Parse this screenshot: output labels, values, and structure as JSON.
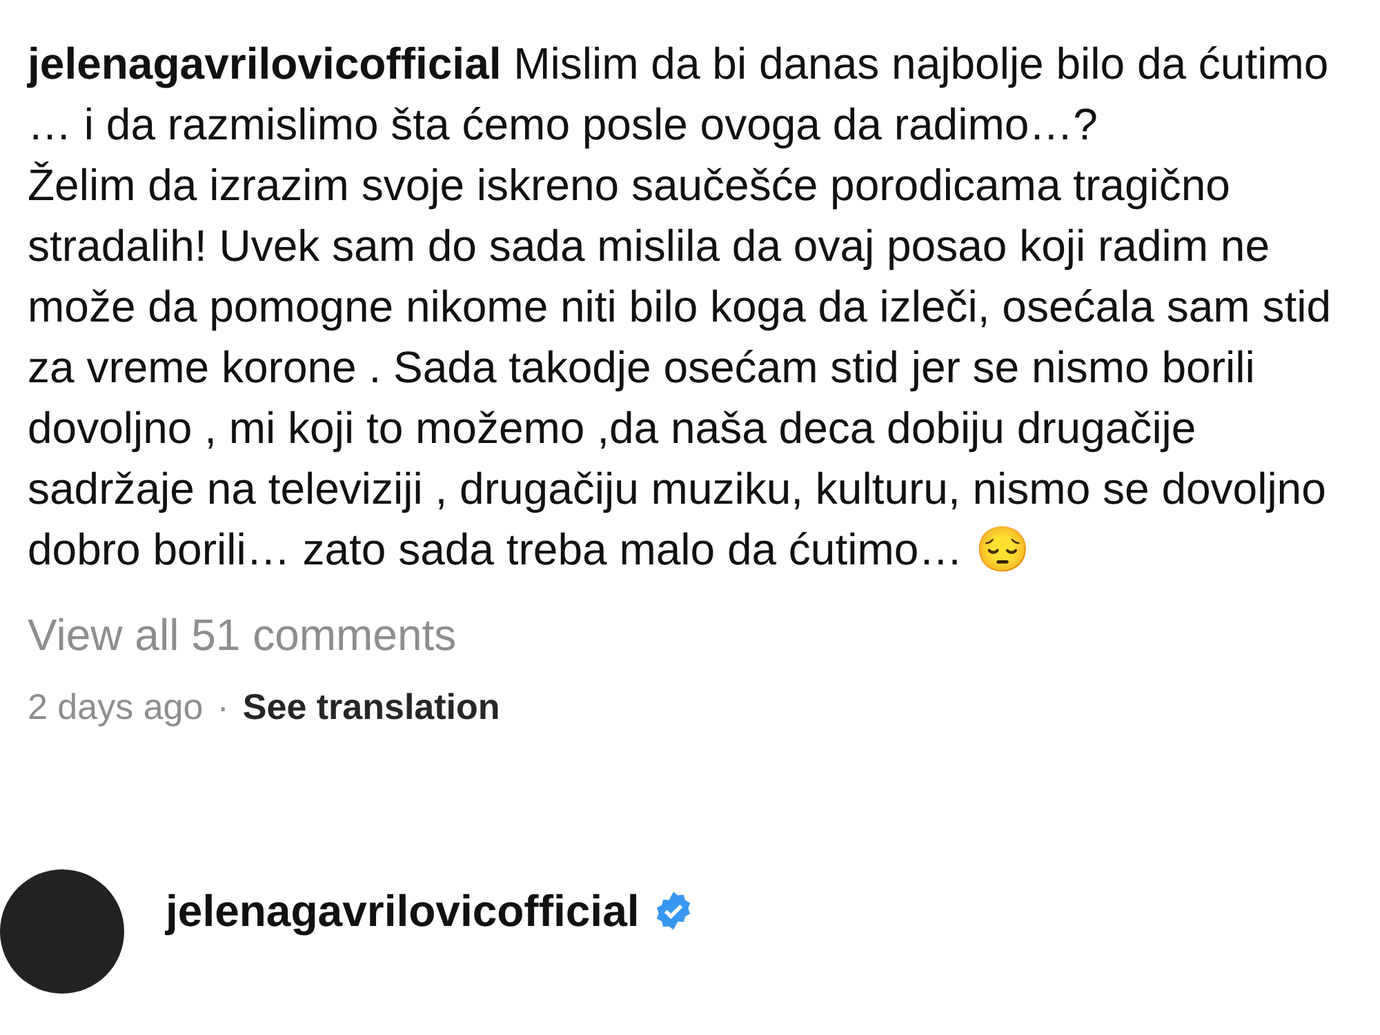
{
  "post": {
    "caption": "**jelenagavrilovicofficial** Mislim da bi danas najbolje bilo da ćutimo … i da razmislimo šta ćemo posle ovoga da radimo…?",
    "caption_continued": "Želim da izrazim svoje iskreno saučešće porodicama tragično stradalih!  Uvek sam do sada mislila da ovaj posao koji radim ne može da pomogne nikome niti bilo koga da izleči, osećala sam stid za vreme korone . Sada takodje osećam stid jer se nismo borili dovoljno , mi koji to možemo ,da naša deca dobiju drugačije sadržaje na televiziji , drugačiju muziku, kulturu, nismo se dovoljno dobro borili… zato sada treba malo da ćutimo… 😔",
    "view_comments": "View all 51 comments",
    "time": "2 days ago",
    "separator": "·",
    "see_translation": "See translation"
  },
  "comment": {
    "username": "jelenagavrilovicofficial",
    "verified": true
  }
}
